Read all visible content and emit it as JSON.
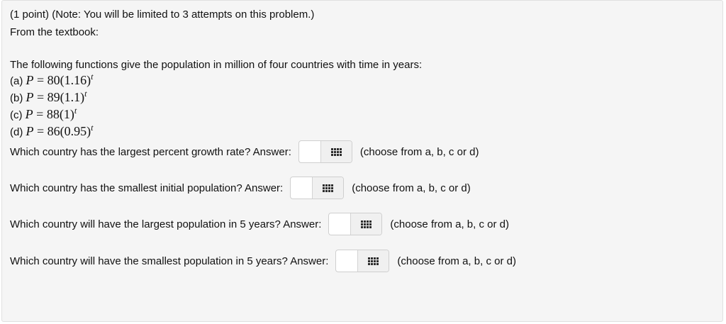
{
  "header": {
    "points": "(1 point) (Note: You will be limited to 3 attempts on this problem.)",
    "source": "From the textbook:"
  },
  "intro": "The following functions give the population in million of four countries with time in years:",
  "functions": [
    {
      "label": "(a)",
      "variable": "P",
      "equals": "=",
      "base": "80(1.16)",
      "exponent": "t"
    },
    {
      "label": "(b)",
      "variable": "P",
      "equals": "=",
      "base": "89(1.1)",
      "exponent": "t"
    },
    {
      "label": "(c)",
      "variable": "P",
      "equals": "=",
      "base": "88(1)",
      "exponent": "t"
    },
    {
      "label": "(d)",
      "variable": "P",
      "equals": "=",
      "base": "86(0.95)",
      "exponent": "t"
    }
  ],
  "questions": [
    {
      "text": "Which country has the largest percent growth rate? Answer:",
      "value": "",
      "hint": "(choose from a, b, c or d)"
    },
    {
      "text": "Which country has the smallest initial population? Answer:",
      "value": "",
      "hint": "(choose from a, b, c or d)"
    },
    {
      "text": "Which country will have the largest population in 5 years? Answer:",
      "value": "",
      "hint": "(choose from a, b, c or d)"
    },
    {
      "text": "Which country will have the smallest population in 5 years? Answer:",
      "value": "",
      "hint": "(choose from a, b, c or d)"
    }
  ],
  "icons": {
    "answer_button": "grid-icon"
  }
}
